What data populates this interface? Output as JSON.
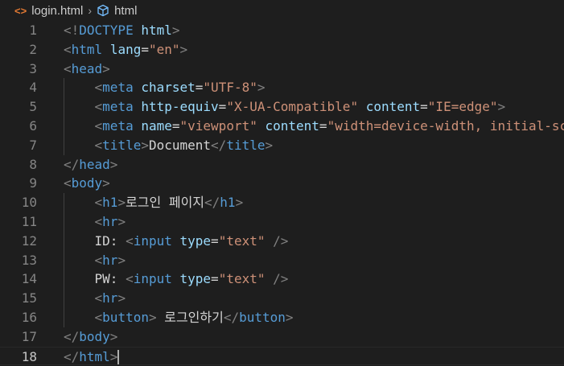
{
  "breadcrumb": {
    "file": "login.html",
    "element": "html",
    "file_icon": "html-file-icon",
    "element_icon": "cube-icon"
  },
  "colors": {
    "tag": "#569cd6",
    "bracket": "#808080",
    "attr": "#9cdcfe",
    "string": "#ce9178",
    "text": "#d4d4d4",
    "background": "#1e1e1e"
  },
  "editor": {
    "current_line": 18,
    "lines": [
      {
        "n": 1,
        "tokens": [
          [
            "br",
            "<!"
          ],
          [
            "tag",
            "DOCTYPE"
          ],
          [
            "txt",
            " "
          ],
          [
            "attr",
            "html"
          ],
          [
            "br",
            ">"
          ]
        ]
      },
      {
        "n": 2,
        "tokens": [
          [
            "br",
            "<"
          ],
          [
            "tag",
            "html"
          ],
          [
            "txt",
            " "
          ],
          [
            "attr",
            "lang"
          ],
          [
            "txt",
            "="
          ],
          [
            "str",
            "\"en\""
          ],
          [
            "br",
            ">"
          ]
        ]
      },
      {
        "n": 3,
        "tokens": [
          [
            "br",
            "<"
          ],
          [
            "tag",
            "head"
          ],
          [
            "br",
            ">"
          ]
        ]
      },
      {
        "n": 4,
        "tokens": [
          [
            "txt",
            "    "
          ],
          [
            "br",
            "<"
          ],
          [
            "tag",
            "meta"
          ],
          [
            "txt",
            " "
          ],
          [
            "attr",
            "charset"
          ],
          [
            "txt",
            "="
          ],
          [
            "str",
            "\"UTF-8\""
          ],
          [
            "br",
            ">"
          ]
        ]
      },
      {
        "n": 5,
        "tokens": [
          [
            "txt",
            "    "
          ],
          [
            "br",
            "<"
          ],
          [
            "tag",
            "meta"
          ],
          [
            "txt",
            " "
          ],
          [
            "attr",
            "http-equiv"
          ],
          [
            "txt",
            "="
          ],
          [
            "str",
            "\"X-UA-Compatible\""
          ],
          [
            "txt",
            " "
          ],
          [
            "attr",
            "content"
          ],
          [
            "txt",
            "="
          ],
          [
            "str",
            "\"IE=edge\""
          ],
          [
            "br",
            ">"
          ]
        ]
      },
      {
        "n": 6,
        "tokens": [
          [
            "txt",
            "    "
          ],
          [
            "br",
            "<"
          ],
          [
            "tag",
            "meta"
          ],
          [
            "txt",
            " "
          ],
          [
            "attr",
            "name"
          ],
          [
            "txt",
            "="
          ],
          [
            "str",
            "\"viewport\""
          ],
          [
            "txt",
            " "
          ],
          [
            "attr",
            "content"
          ],
          [
            "txt",
            "="
          ],
          [
            "str",
            "\"width=device-width, initial-sc"
          ]
        ]
      },
      {
        "n": 7,
        "tokens": [
          [
            "txt",
            "    "
          ],
          [
            "br",
            "<"
          ],
          [
            "tag",
            "title"
          ],
          [
            "br",
            ">"
          ],
          [
            "txt",
            "Document"
          ],
          [
            "br",
            "</"
          ],
          [
            "tag",
            "title"
          ],
          [
            "br",
            ">"
          ]
        ]
      },
      {
        "n": 8,
        "tokens": [
          [
            "br",
            "</"
          ],
          [
            "tag",
            "head"
          ],
          [
            "br",
            ">"
          ]
        ]
      },
      {
        "n": 9,
        "tokens": [
          [
            "br",
            "<"
          ],
          [
            "tag",
            "body"
          ],
          [
            "br",
            ">"
          ]
        ]
      },
      {
        "n": 10,
        "tokens": [
          [
            "txt",
            "    "
          ],
          [
            "br",
            "<"
          ],
          [
            "tag",
            "h1"
          ],
          [
            "br",
            ">"
          ],
          [
            "txt",
            "로그인 페이지"
          ],
          [
            "br",
            "</"
          ],
          [
            "tag",
            "h1"
          ],
          [
            "br",
            ">"
          ]
        ]
      },
      {
        "n": 11,
        "tokens": [
          [
            "txt",
            "    "
          ],
          [
            "br",
            "<"
          ],
          [
            "tag",
            "hr"
          ],
          [
            "br",
            ">"
          ]
        ]
      },
      {
        "n": 12,
        "tokens": [
          [
            "txt",
            "    ID: "
          ],
          [
            "br",
            "<"
          ],
          [
            "tag",
            "input"
          ],
          [
            "txt",
            " "
          ],
          [
            "attr",
            "type"
          ],
          [
            "txt",
            "="
          ],
          [
            "str",
            "\"text\""
          ],
          [
            "txt",
            " "
          ],
          [
            "br",
            "/>"
          ]
        ]
      },
      {
        "n": 13,
        "tokens": [
          [
            "txt",
            "    "
          ],
          [
            "br",
            "<"
          ],
          [
            "tag",
            "hr"
          ],
          [
            "br",
            ">"
          ]
        ]
      },
      {
        "n": 14,
        "tokens": [
          [
            "txt",
            "    PW: "
          ],
          [
            "br",
            "<"
          ],
          [
            "tag",
            "input"
          ],
          [
            "txt",
            " "
          ],
          [
            "attr",
            "type"
          ],
          [
            "txt",
            "="
          ],
          [
            "str",
            "\"text\""
          ],
          [
            "txt",
            " "
          ],
          [
            "br",
            "/>"
          ]
        ]
      },
      {
        "n": 15,
        "tokens": [
          [
            "txt",
            "    "
          ],
          [
            "br",
            "<"
          ],
          [
            "tag",
            "hr"
          ],
          [
            "br",
            ">"
          ]
        ]
      },
      {
        "n": 16,
        "tokens": [
          [
            "txt",
            "    "
          ],
          [
            "br",
            "<"
          ],
          [
            "tag",
            "button"
          ],
          [
            "br",
            ">"
          ],
          [
            "txt",
            " 로그인하기"
          ],
          [
            "br",
            "</"
          ],
          [
            "tag",
            "button"
          ],
          [
            "br",
            ">"
          ]
        ]
      },
      {
        "n": 17,
        "tokens": [
          [
            "br",
            "</"
          ],
          [
            "tag",
            "body"
          ],
          [
            "br",
            ">"
          ]
        ]
      },
      {
        "n": 18,
        "tokens": [
          [
            "br",
            "</"
          ],
          [
            "tag",
            "html"
          ],
          [
            "br",
            ">"
          ]
        ]
      }
    ]
  }
}
